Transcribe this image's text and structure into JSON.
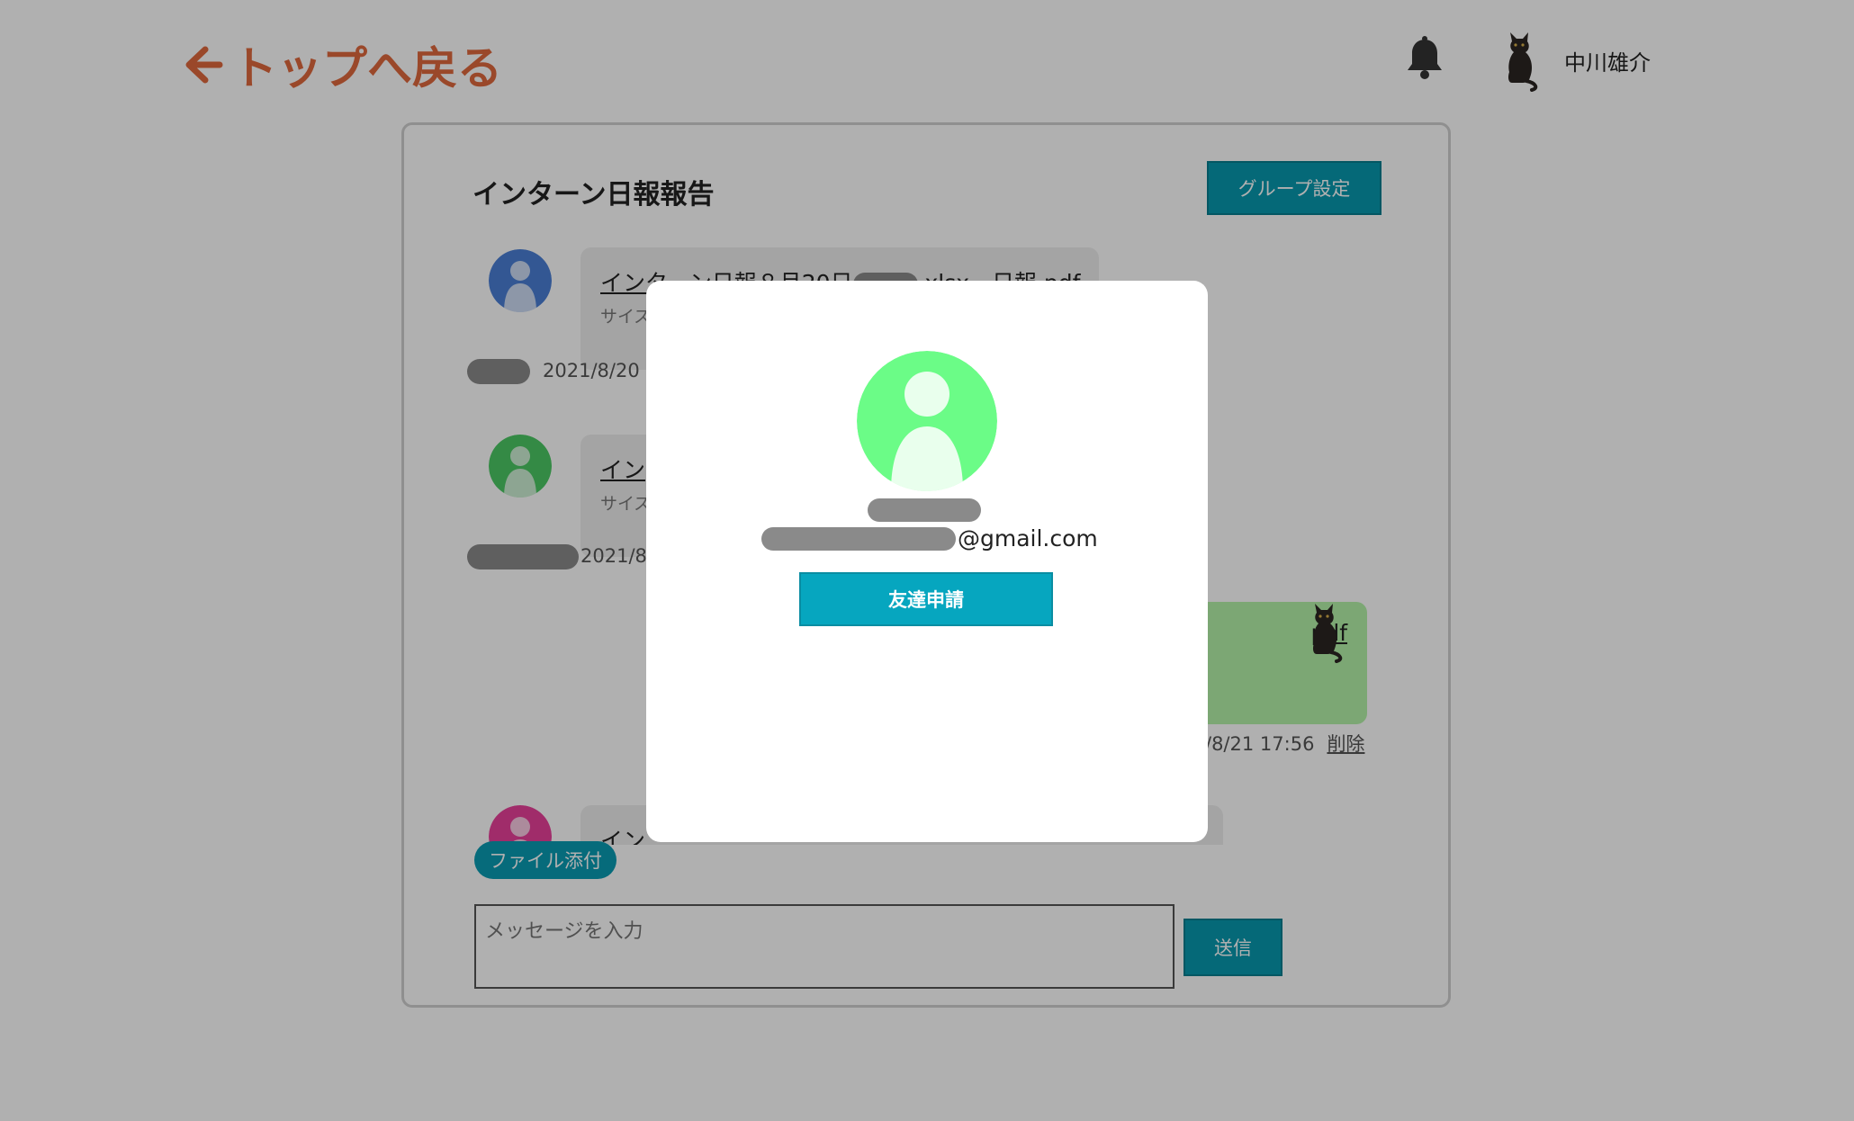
{
  "header": {
    "back_label": "トップへ戻る",
    "user_name": "中川雄介"
  },
  "chat": {
    "group_title": "インターン日報報告",
    "group_settings_label": "グループ設定",
    "messages": [
      {
        "file_prefix": "インターン日報８月20日",
        "file_suffix": ".xlsx - 日報.pdf",
        "size_prefix": "サイズ",
        "date": "2021/8/20",
        "avatar_color": "#4a7fd6"
      },
      {
        "file_prefix": "イン",
        "size_prefix": "サイズ",
        "date": "2021/8",
        "avatar_color": "#4cc864"
      },
      {
        "file_suffix": "pdf",
        "date": "/8/21 17:56",
        "delete_label": "削除"
      },
      {
        "file_prefix": "イン",
        "avatar_color": "#e8409a"
      }
    ],
    "attach_label": "ファイル添付",
    "input_placeholder": "メッセージを入力",
    "send_label": "送信"
  },
  "modal": {
    "email_domain": "@gmail.com",
    "friend_request_label": "友達申請",
    "avatar_color": "#6bfc87"
  }
}
